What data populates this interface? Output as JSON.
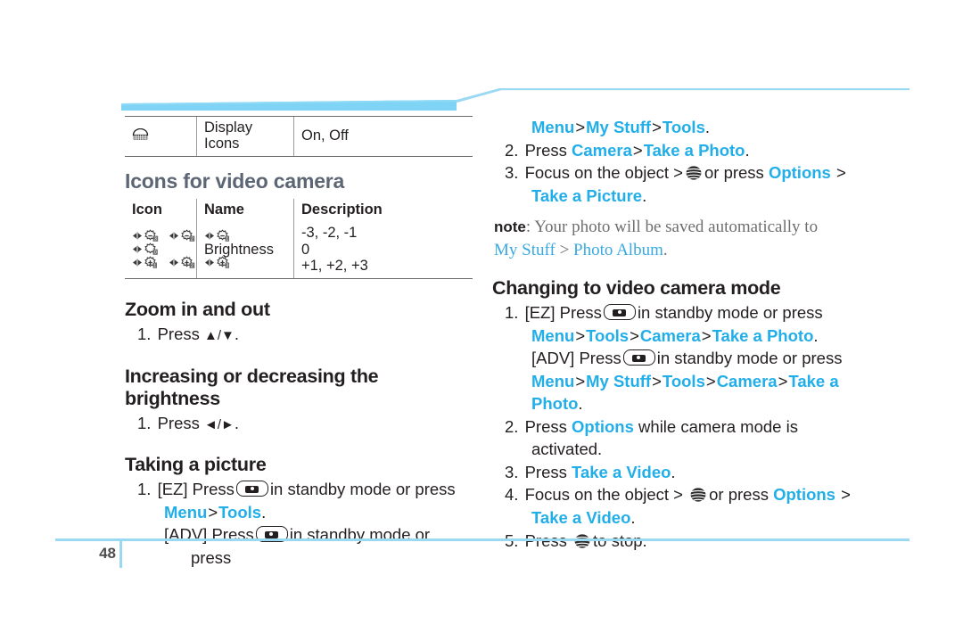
{
  "colors": {
    "link": "#22aee8",
    "heading_blue_gray": "#5d6674",
    "banner_blue": "#7fd4f5",
    "footer_rule": "#9bd9f3",
    "body_text": "#231f20",
    "note_text": "#6e6e6e"
  },
  "left": {
    "display_icons_row": {
      "icon": "display-icons-glyph",
      "name": "Display Icons",
      "description": "On, Off"
    },
    "section_heading": "Icons for video camera",
    "icon_table": {
      "headers": [
        "Icon",
        "Name",
        "Description"
      ],
      "rows": [
        {
          "icon": "brightness-levels-glyphs",
          "name": "Brightness",
          "description_lines": [
            "-3, -2, -1",
            "0",
            "+1, +2, +3"
          ]
        }
      ]
    },
    "zoom_heading": "Zoom in and out",
    "zoom_steps": [
      {
        "num": "1.",
        "text_before": "Press ",
        "keys": "▲/▼",
        "text_after": "."
      }
    ],
    "brightness_heading": "Increasing or decreasing the brightness",
    "brightness_steps": [
      {
        "num": "1.",
        "text_before": "Press ",
        "keys": "◄/►",
        "text_after": "."
      }
    ],
    "picture_heading": "Taking a picture",
    "picture_step_num": "1.",
    "picture_ez_prefix": "[EZ] Press",
    "picture_ez_suffix": "in standby mode or press",
    "picture_ez_path": [
      "Menu",
      "Tools"
    ],
    "picture_adv_prefix": "[ADV] Press",
    "picture_adv_suffix": "in standby mode or press"
  },
  "right": {
    "cont_path": [
      "Menu",
      "My Stuff",
      "Tools"
    ],
    "step2": {
      "num": "2.",
      "prefix": "Press ",
      "path": [
        "Camera",
        "Take a Photo"
      ]
    },
    "step3": {
      "num": "3.",
      "prefix": "Focus on the object >",
      "mid": "or press",
      "options": "Options",
      "gt": ">",
      "cont": "Take a Picture"
    },
    "note": {
      "label": "note",
      "colon": ": ",
      "body": "Your photo will be saved automatically to",
      "path": [
        "My Stuff",
        "Photo Album"
      ]
    },
    "video_heading": "Changing to video camera mode",
    "video_step1_num": "1.",
    "video_ez_prefix": "[EZ] Press",
    "video_ez_suffix": "in standby mode or press",
    "video_ez_path": [
      "Menu",
      "Tools",
      "Camera",
      "Take a Photo"
    ],
    "video_adv_prefix": "[ADV] Press",
    "video_adv_suffix": "in standby mode or press",
    "video_adv_path": [
      "Menu",
      "My Stuff",
      "Tools",
      "Camera",
      "Take a",
      "Photo"
    ],
    "step2b": {
      "num": "2.",
      "prefix": "Press ",
      "options": "Options",
      "suffix": "while camera mode is",
      "cont": "activated."
    },
    "step3b": {
      "num": "3.",
      "prefix": "Press ",
      "link": "Take a Video",
      "suffix": "."
    },
    "step4": {
      "num": "4.",
      "prefix": "Focus on the object >",
      "mid": "or press",
      "options": "Options",
      "gt": ">",
      "cont": "Take a Video"
    },
    "step5": {
      "num": "5.",
      "prefix": "Press",
      "suffix": "to stop."
    }
  },
  "footer": {
    "page_number": "48"
  }
}
